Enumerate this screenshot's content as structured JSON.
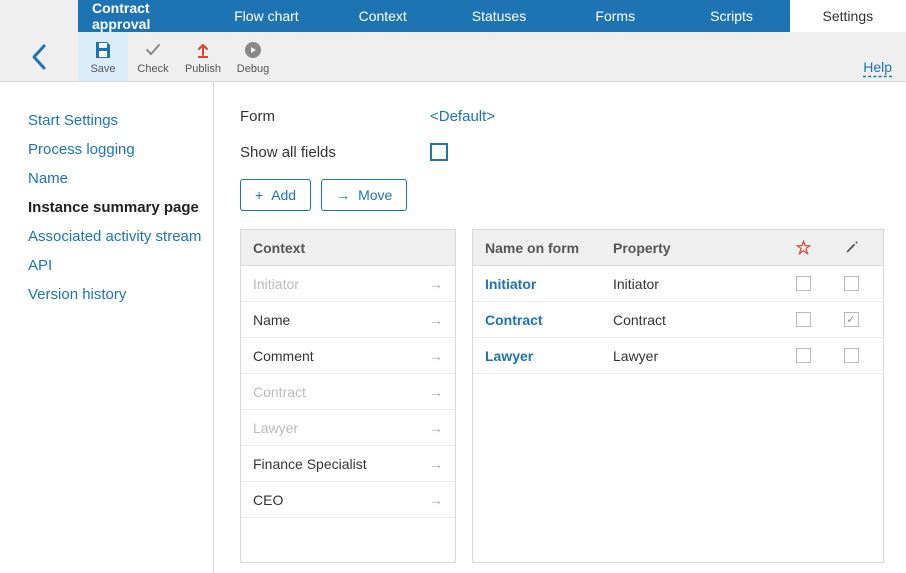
{
  "tabs": {
    "title": "Contract approval",
    "flowchart": "Flow chart",
    "context": "Context",
    "statuses": "Statuses",
    "forms": "Forms",
    "scripts": "Scripts",
    "settings": "Settings"
  },
  "toolbar": {
    "save": "Save",
    "check": "Check",
    "publish": "Publish",
    "debug": "Debug",
    "help": "Help"
  },
  "sidebar": {
    "items": [
      "Start Settings",
      "Process logging",
      "Name",
      "Instance summary page",
      "Associated activity stream",
      "API",
      "Version history"
    ],
    "active_index": 3
  },
  "form_section": {
    "form_label": "Form",
    "form_value": "<Default>",
    "show_all_label": "Show all fields",
    "show_all_checked": false,
    "add_label": "Add",
    "move_label": "Move"
  },
  "context_table": {
    "header": "Context",
    "rows": [
      {
        "label": "Initiator",
        "dim": true
      },
      {
        "label": "Name",
        "dim": false
      },
      {
        "label": "Comment",
        "dim": false
      },
      {
        "label": "Contract",
        "dim": true
      },
      {
        "label": "Lawyer",
        "dim": true
      },
      {
        "label": "Finance Specialist",
        "dim": false
      },
      {
        "label": "CEO",
        "dim": false
      }
    ]
  },
  "form_table": {
    "header_name": "Name on form",
    "header_property": "Property",
    "rows": [
      {
        "name": "Initiator",
        "property": "Initiator",
        "required": false,
        "edit": false
      },
      {
        "name": "Contract",
        "property": "Contract",
        "required": false,
        "edit": true
      },
      {
        "name": "Lawyer",
        "property": "Lawyer",
        "required": false,
        "edit": false
      }
    ]
  }
}
